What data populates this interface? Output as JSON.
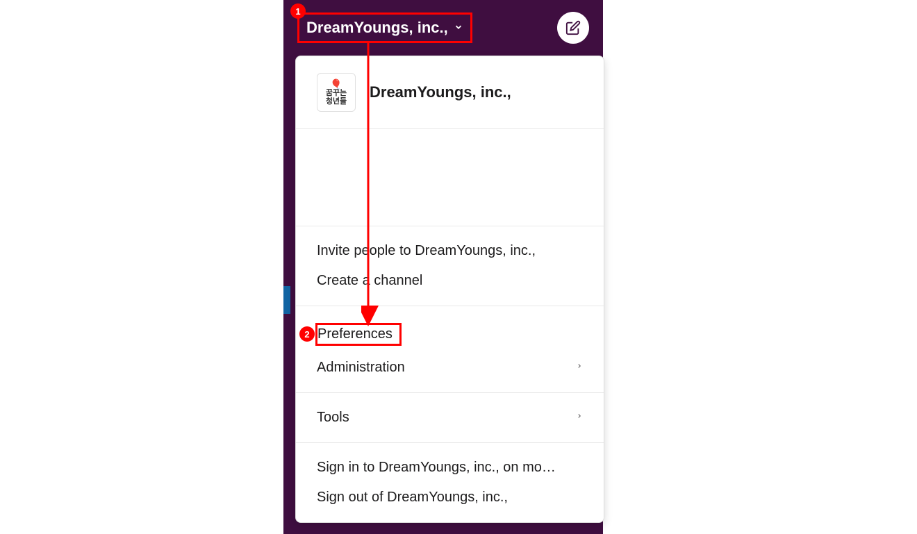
{
  "header": {
    "workspace_name": "DreamYoungs, inc.,",
    "logo_text_line1": "꿈꾸는",
    "logo_text_line2": "청년들"
  },
  "dropdown": {
    "workspace_title": "DreamYoungs, inc.,",
    "sections": [
      {
        "items": [
          {
            "label": "Invite people to DreamYoungs, inc.,",
            "has_submenu": false
          },
          {
            "label": "Create a channel",
            "has_submenu": false
          }
        ]
      },
      {
        "items": [
          {
            "label": "Preferences",
            "has_submenu": false,
            "highlighted": true
          },
          {
            "label": "Administration",
            "has_submenu": true
          }
        ]
      },
      {
        "items": [
          {
            "label": "Tools",
            "has_submenu": true
          }
        ]
      },
      {
        "items": [
          {
            "label": "Sign in to DreamYoungs, inc., on mo…",
            "has_submenu": false
          },
          {
            "label": "Sign out of DreamYoungs, inc.,",
            "has_submenu": false
          }
        ]
      }
    ]
  },
  "annotations": {
    "badge1": "1",
    "badge2": "2"
  }
}
